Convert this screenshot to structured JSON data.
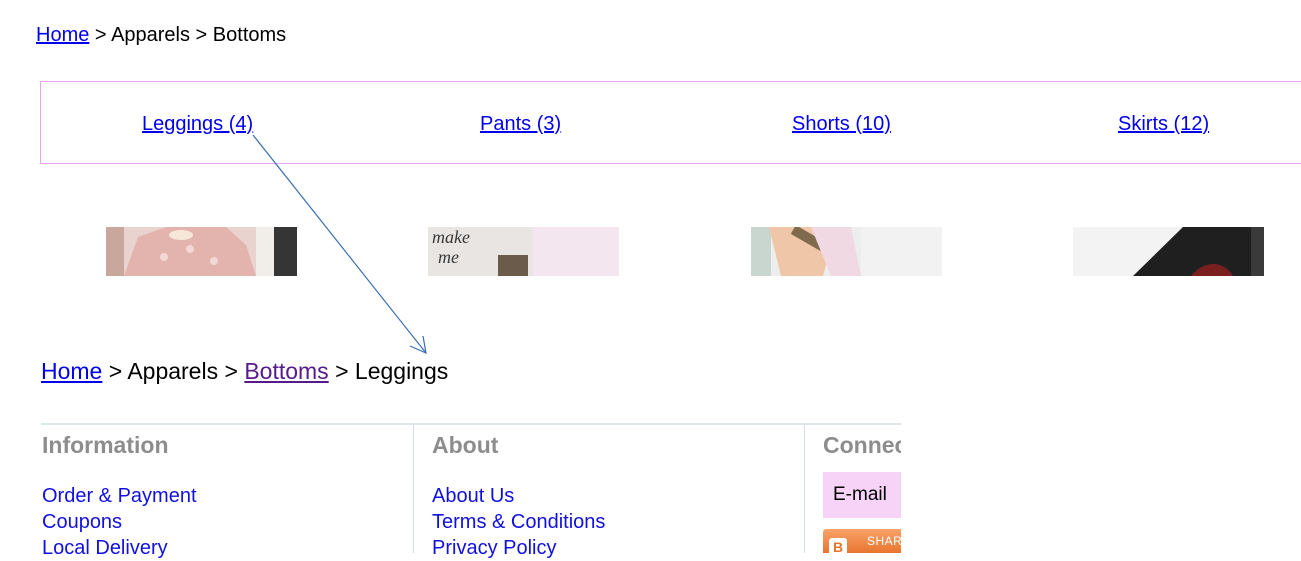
{
  "breadcrumb_top": {
    "home": "Home",
    "sep1": " > ",
    "apparels": "Apparels",
    "sep2": " > ",
    "current": "Bottoms"
  },
  "categories": [
    {
      "label": "Leggings (4)"
    },
    {
      "label": "Pants (3)"
    },
    {
      "label": "Shorts (10)"
    },
    {
      "label": "Skirts (12)"
    }
  ],
  "thumbnails": [
    {
      "alt": "Leggings product photo"
    },
    {
      "alt": "Pants product photo"
    },
    {
      "alt": "Shorts product photo"
    },
    {
      "alt": "Skirts product photo"
    }
  ],
  "breadcrumb_bottom": {
    "home": "Home",
    "sep1": " > ",
    "apparels": "Apparels",
    "sep2": " > ",
    "bottoms": "Bottoms",
    "sep3": " > ",
    "current": "Leggings"
  },
  "footer": {
    "information": {
      "heading": "Information",
      "links": [
        "Order & Payment",
        "Coupons",
        "Local Delivery"
      ]
    },
    "about": {
      "heading": "About",
      "links": [
        "About Us",
        "Terms & Conditions",
        "Privacy Policy"
      ]
    },
    "connect": {
      "heading": "Connect",
      "email_label": "E-mail",
      "share_label": "SHARE"
    }
  },
  "colors": {
    "link": "#0000ee",
    "visited": "#551a8b",
    "catbar_border": "#e8a6ec",
    "email_bg": "#f7d3f7",
    "arrow": "#3a6fb0"
  }
}
